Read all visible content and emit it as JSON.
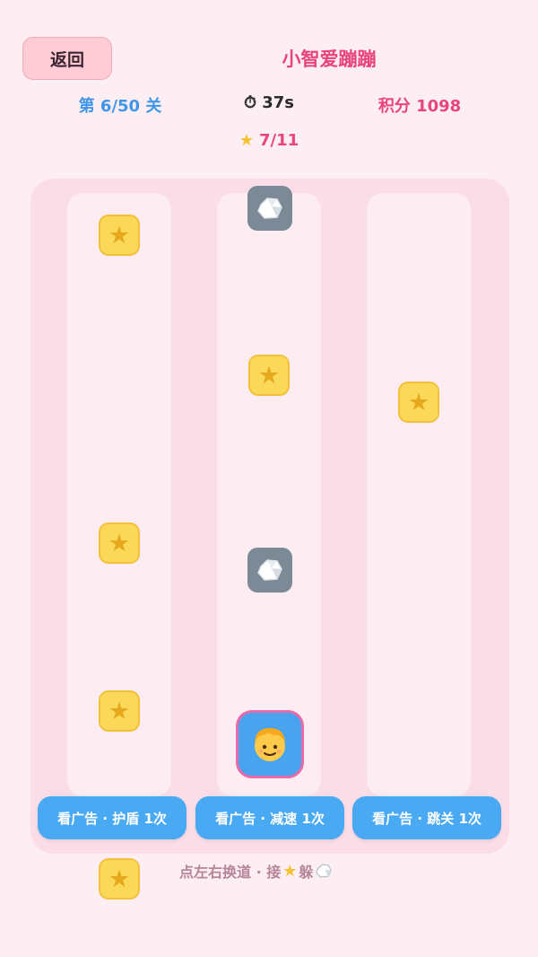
{
  "header": {
    "back_label": "返回",
    "title": "小智爱蹦蹦"
  },
  "stats": {
    "level": "第 6/50 关",
    "timer_icon": "stopwatch-icon",
    "timer": "⏱ 37s",
    "score": "积分 1098",
    "stars": "7/11",
    "stars_icon": "star-icon"
  },
  "game": {
    "lanes": 3,
    "player_lane": "middle",
    "player_icon": "blond-face-emoji-icon",
    "items": [
      {
        "type": "star",
        "lane": "left"
      },
      {
        "type": "star",
        "lane": "left"
      },
      {
        "type": "star",
        "lane": "left"
      },
      {
        "type": "star",
        "lane": "left"
      },
      {
        "type": "rock",
        "lane": "middle"
      },
      {
        "type": "star",
        "lane": "middle"
      },
      {
        "type": "rock",
        "lane": "middle"
      },
      {
        "type": "star",
        "lane": "right"
      }
    ]
  },
  "ads": {
    "shield": "看广告 · 护盾 1次",
    "slow": "看广告 · 减速 1次",
    "skip": "看广告 · 跳关 1次"
  },
  "hint": {
    "prefix": "点左右换道 · 接",
    "middle": "躲",
    "star_icon": "star-icon",
    "rock_icon": "rock-icon"
  },
  "colors": {
    "background": "#fdeef3",
    "accent_pink": "#e8457a",
    "accent_blue": "#3f96e8",
    "button_blue": "#4aa9f3",
    "star_yellow": "#fcd858",
    "rock_gray": "#7b8a96"
  }
}
